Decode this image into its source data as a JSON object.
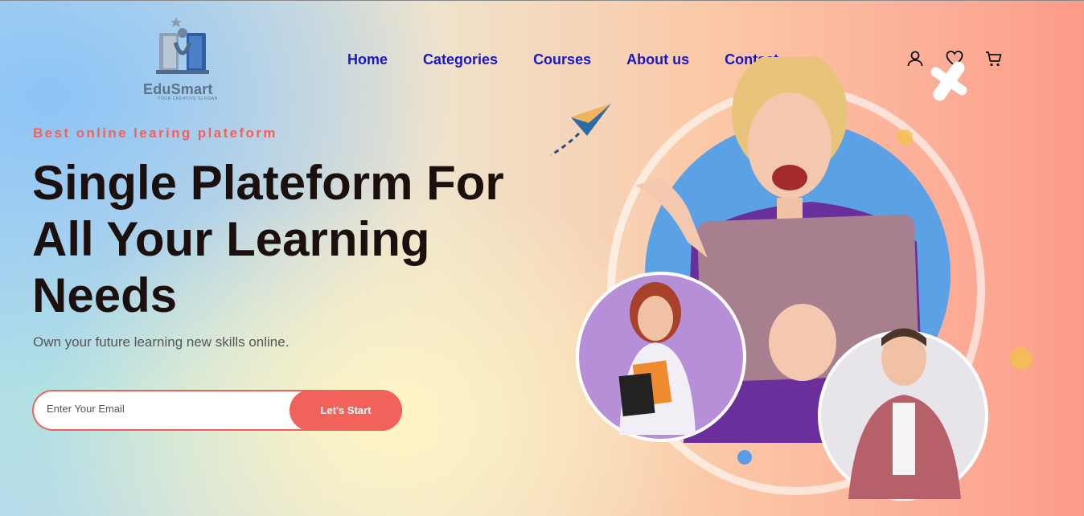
{
  "brand": {
    "name": "EduSmart",
    "slogan": "YOUR CREATIVE SLOGAN",
    "logo_icon": "book-logo-icon"
  },
  "nav": {
    "items": [
      "Home",
      "Categories",
      "Courses",
      "About us",
      "Contact"
    ]
  },
  "header_icons": [
    "user-icon",
    "heart-icon",
    "cart-icon"
  ],
  "hero": {
    "kicker": "Best online learing plateform",
    "title_line1": "Single Plateform For",
    "title_line2": "All Your Learning",
    "title_line3": "Needs",
    "subtitle": "Own your future learning new skills online.",
    "email_placeholder": "Enter Your Email",
    "cta_label": "Let's Start"
  },
  "colors": {
    "accent": "#f0625a",
    "nav": "#1a17c4",
    "heading": "#1b100e"
  }
}
